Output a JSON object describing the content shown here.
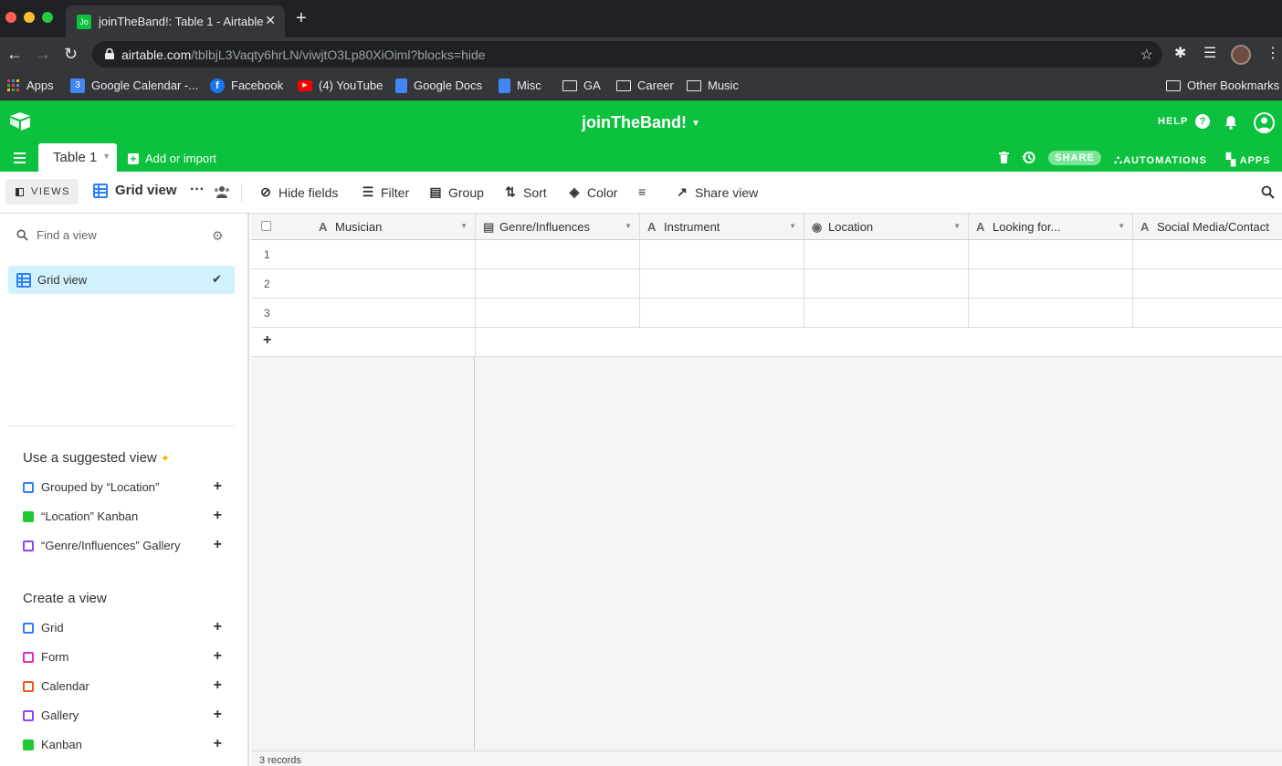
{
  "browser": {
    "tab_title": "joinTheBand!: Table 1 - Airtable",
    "tab_favicon_text": "Jo",
    "url_domain": "airtable.com",
    "url_path": "/tblbjL3Vaqty6hrLN/viwjtO3Lp80XiOiml?blocks=hide",
    "bookmarks": [
      {
        "label": "Apps",
        "icon": "apps-grid-icon",
        "color": "#ea4335"
      },
      {
        "label": "Google Calendar -...",
        "icon": "google-calendar-icon",
        "color": "#4285f4"
      },
      {
        "label": "Facebook",
        "icon": "facebook-icon",
        "color": "#1877f2"
      },
      {
        "label": "(4) YouTube",
        "icon": "youtube-icon",
        "color": "#ff0000"
      },
      {
        "label": "Google Docs",
        "icon": "google-docs-icon",
        "color": "#4285f4"
      },
      {
        "label": "Misc",
        "icon": "google-docs-icon",
        "color": "#4285f4"
      },
      {
        "label": "GA",
        "icon": "folder-icon"
      },
      {
        "label": "Career",
        "icon": "folder-icon"
      },
      {
        "label": "Music",
        "icon": "folder-icon"
      }
    ],
    "other_bookmarks": "Other Bookmarks"
  },
  "header": {
    "base_name": "joinTheBand!",
    "help_label": "HELP",
    "table_tab": "Table 1",
    "add_import": "Add or import",
    "share_label": "SHARE",
    "automations_label": "AUTOMATIONS",
    "apps_label": "APPS",
    "brand_color": "#0bc13d"
  },
  "viewbar": {
    "views_label": "VIEWS",
    "current_view": "Grid view",
    "hide_fields": "Hide fields",
    "filter": "Filter",
    "group": "Group",
    "sort": "Sort",
    "color": "Color",
    "share_view": "Share view"
  },
  "sidebar": {
    "find_placeholder": "Find a view",
    "selected_view": "Grid view",
    "suggested_heading": "Use a suggested view",
    "suggested": [
      {
        "label": "Grouped by “Location”",
        "icon": "grid-icon",
        "color": "#2d7ff9"
      },
      {
        "label": "“Location” Kanban",
        "icon": "kanban-icon",
        "color": "#20c933"
      },
      {
        "label": "“Genre/Influences” Gallery",
        "icon": "gallery-icon",
        "color": "#8b46ff"
      }
    ],
    "create_heading": "Create a view",
    "create": [
      {
        "label": "Grid",
        "icon": "grid-icon",
        "color": "#2d7ff9"
      },
      {
        "label": "Form",
        "icon": "form-icon",
        "color": "#e929ba"
      },
      {
        "label": "Calendar",
        "icon": "calendar-icon",
        "color": "#f82b60"
      },
      {
        "label": "Gallery",
        "icon": "gallery-icon",
        "color": "#8b46ff"
      },
      {
        "label": "Kanban",
        "icon": "kanban-icon",
        "color": "#20c933"
      }
    ]
  },
  "grid": {
    "columns": [
      {
        "label": "Musician",
        "icon": "A"
      },
      {
        "label": "Genre/Influences",
        "icon": "▤"
      },
      {
        "label": "Instrument",
        "icon": "A"
      },
      {
        "label": "Location",
        "icon": "◉"
      },
      {
        "label": "Looking for...",
        "icon": "A"
      },
      {
        "label": "Social Media/Contact",
        "icon": "A"
      }
    ],
    "rows": [
      "1",
      "2",
      "3"
    ],
    "record_count": "3 records"
  }
}
